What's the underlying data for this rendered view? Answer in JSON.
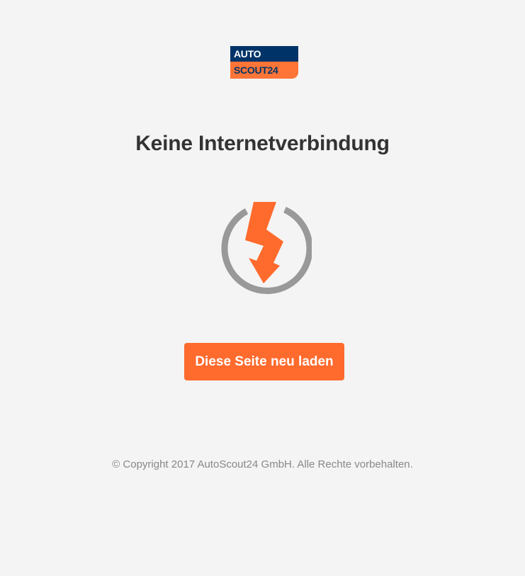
{
  "logo": {
    "line1": "AUTO",
    "line2": "SCOUT24"
  },
  "page": {
    "title": "Keine Internetverbindung"
  },
  "icon": {
    "name": "offline-lightning-icon"
  },
  "actions": {
    "reload_label": "Diese Seite neu laden"
  },
  "footer": {
    "copyright": "© Copyright 2017 AutoScout24 GmbH. Alle Rechte vorbehalten."
  },
  "colors": {
    "background": "#f4f4f4",
    "brand_blue": "#003468",
    "brand_orange": "#ff7437",
    "button": "#ff6a2d",
    "ring": "#999999",
    "title": "#333333",
    "footer_text": "#888888"
  }
}
